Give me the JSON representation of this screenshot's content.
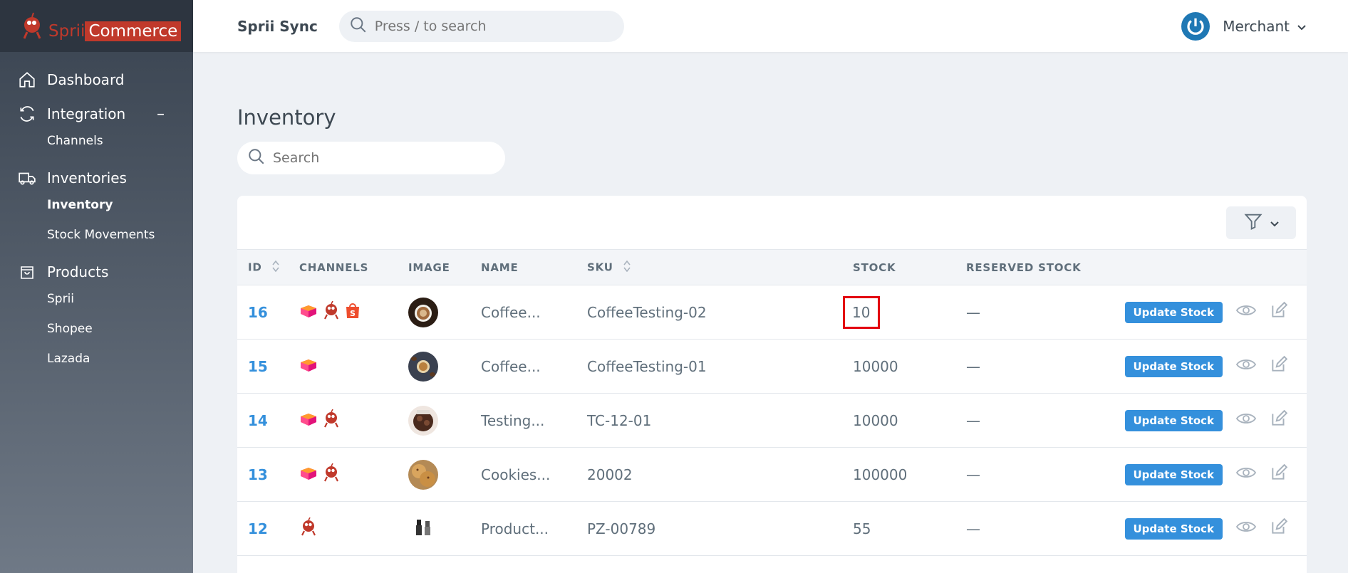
{
  "brand": {
    "part1": "Sprii",
    "part2": "Commerce"
  },
  "header": {
    "app_name": "Sprii Sync",
    "search_placeholder": "Press / to search",
    "user_label": "Merchant"
  },
  "sidebar": {
    "dashboard": "Dashboard",
    "integration": "Integration",
    "integration_toggle": "–",
    "channels": "Channels",
    "inventories": "Inventories",
    "inventory": "Inventory",
    "stock_movements": "Stock Movements",
    "products": "Products",
    "products_sprii": "Sprii",
    "products_shopee": "Shopee",
    "products_lazada": "Lazada"
  },
  "main": {
    "title": "Inventory",
    "search_placeholder": "Search"
  },
  "table": {
    "headers": {
      "id": "ID",
      "channels": "CHANNELS",
      "image": "IMAGE",
      "name": "NAME",
      "sku": "SKU",
      "stock": "STOCK",
      "reserved": "RESERVED STOCK"
    },
    "action_label": "Update Stock",
    "rows": [
      {
        "id": "16",
        "channels": [
          "lazada",
          "sprii",
          "shopee"
        ],
        "image": "coffee-cup",
        "name": "Coffee...",
        "sku": "CoffeeTesting-02",
        "stock": "10",
        "reserved": "—"
      },
      {
        "id": "15",
        "channels": [
          "lazada"
        ],
        "image": "coffee-beans",
        "name": "Coffee...",
        "sku": "CoffeeTesting-01",
        "stock": "10000",
        "reserved": "—"
      },
      {
        "id": "14",
        "channels": [
          "lazada",
          "sprii"
        ],
        "image": "chocolate",
        "name": "Testing...",
        "sku": "TC-12-01",
        "stock": "10000",
        "reserved": "—"
      },
      {
        "id": "13",
        "channels": [
          "lazada",
          "sprii"
        ],
        "image": "cookies",
        "name": "Cookies...",
        "sku": "20002",
        "stock": "100000",
        "reserved": "—"
      },
      {
        "id": "12",
        "channels": [
          "sprii"
        ],
        "image": "figures",
        "name": "Product...",
        "sku": "PZ-00789",
        "stock": "55",
        "reserved": "—"
      }
    ]
  },
  "colors": {
    "accent": "#3490dc",
    "brand_red": "#c0392b",
    "highlight": "#e3000f"
  }
}
